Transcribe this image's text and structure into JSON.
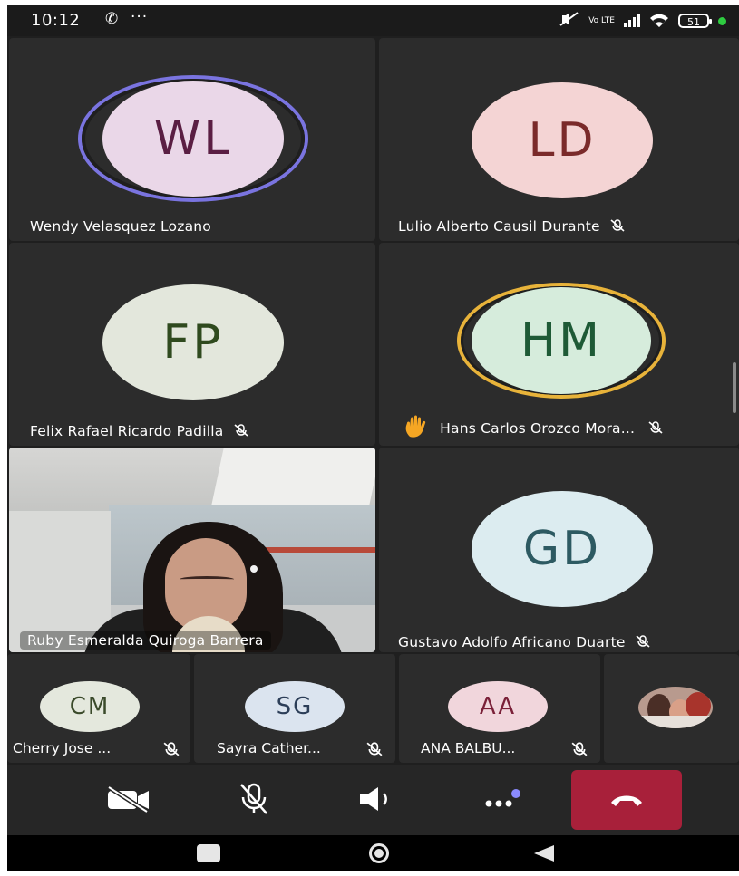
{
  "status_bar": {
    "time": "10:12",
    "battery": "51",
    "network_label": "Vo LTE",
    "icons": [
      "call-icon",
      "more-dots-icon",
      "vibrate-off-icon",
      "volte-icon",
      "signal-icon",
      "wifi-icon",
      "battery-icon",
      "active-dot-icon"
    ]
  },
  "participants": [
    {
      "initials": "WL",
      "name": "Wendy Velasquez Lozano",
      "muted": false,
      "speaking": true,
      "avatar_bg": "#ead7e8",
      "avatar_fg": "#5a1e43",
      "ring": "#7a74e0"
    },
    {
      "initials": "LD",
      "name": "Lulio Alberto Causil Durante",
      "muted": true,
      "avatar_bg": "#f4d4d4",
      "avatar_fg": "#7a2a2a"
    },
    {
      "initials": "FP",
      "name": "Felix Rafael Ricardo Padilla",
      "muted": true,
      "avatar_bg": "#e3e7dc",
      "avatar_fg": "#2f4a1e"
    },
    {
      "initials": "HM",
      "name": "Hans Carlos Orozco Mora...",
      "muted": true,
      "hand_raised": true,
      "avatar_bg": "#d6ecdc",
      "avatar_fg": "#1e5a36",
      "ring": "#e8b33a"
    },
    {
      "initials": "",
      "name": "Ruby Esmeralda Quiroga Barrera",
      "muted": false,
      "video": true
    },
    {
      "initials": "GD",
      "name": "Gustavo Adolfo Africano Duarte",
      "muted": true,
      "avatar_bg": "#dcecf0",
      "avatar_fg": "#2d5a62"
    }
  ],
  "small_participants": [
    {
      "initials": "CM",
      "name": "Cherry Jose ...",
      "muted": true,
      "avatar_bg": "#e4e8dd",
      "avatar_fg": "#3a4a2a"
    },
    {
      "initials": "SG",
      "name": "Sayra Cather...",
      "muted": true,
      "avatar_bg": "#dbe4ef",
      "avatar_fg": "#2c3e58"
    },
    {
      "initials": "AA",
      "name": "ANA BALBU...",
      "muted": true,
      "avatar_bg": "#f1d6dc",
      "avatar_fg": "#7a2038"
    },
    {
      "initials": "",
      "name": "",
      "photo": true
    }
  ],
  "controls": {
    "camera": "camera-off-icon",
    "mic": "mic-off-icon",
    "speaker": "speaker-icon",
    "more": "more-options-icon",
    "hangup": "hang-up-icon",
    "hangup_color": "#a8203a",
    "notify_dot_color": "#8a8aff"
  },
  "nav": {
    "recents": "recents-icon",
    "home": "home-icon",
    "back": "back-icon"
  }
}
